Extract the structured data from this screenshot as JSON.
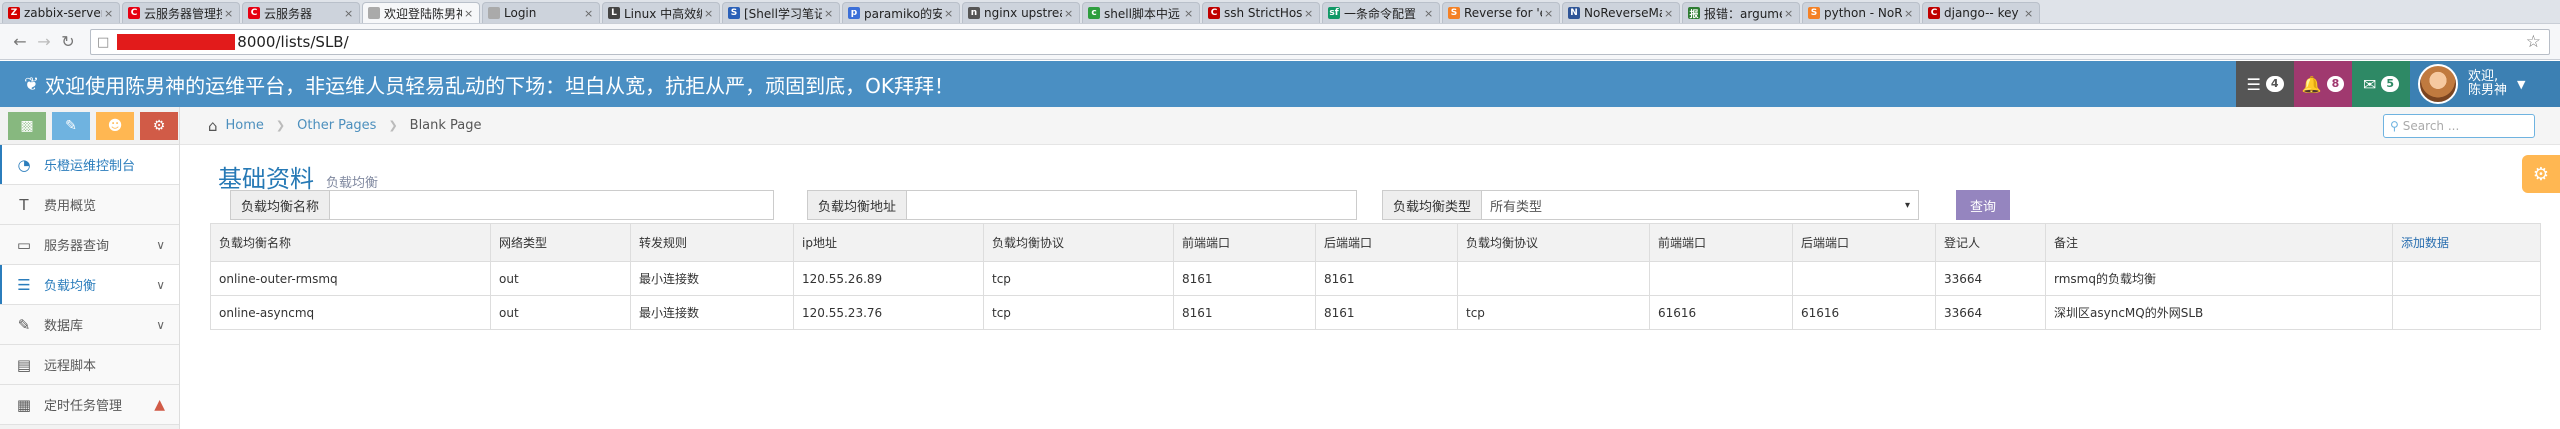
{
  "browser": {
    "tabs": [
      {
        "title": "zabbix-server",
        "fav": "Z",
        "color": "#d40000",
        "active": false
      },
      {
        "title": "云服务器管理控",
        "fav": "C",
        "color": "#e60012",
        "active": false
      },
      {
        "title": "云服务器",
        "fav": "C",
        "color": "#e60012",
        "active": false
      },
      {
        "title": "欢迎登陆陈男神",
        "fav": "",
        "color": "#aaaaaa",
        "active": true
      },
      {
        "title": "Login",
        "fav": "",
        "color": "#aaaaaa",
        "active": false
      },
      {
        "title": "Linux 中高效编",
        "fav": "L",
        "color": "#444444",
        "active": false
      },
      {
        "title": "[Shell学习笔记",
        "fav": "S",
        "color": "#2a60b8",
        "active": false
      },
      {
        "title": "paramiko的安",
        "fav": "p",
        "color": "#3b6fd8",
        "active": false
      },
      {
        "title": "nginx upstrea",
        "fav": "n",
        "color": "#555555",
        "active": false
      },
      {
        "title": "shell脚本中远",
        "fav": "c",
        "color": "#2e9e3e",
        "active": false
      },
      {
        "title": "ssh StrictHost",
        "fav": "C",
        "color": "#c00000",
        "active": false
      },
      {
        "title": "一条命令配置",
        "fav": "sf",
        "color": "#119966",
        "active": false
      },
      {
        "title": "Reverse for 'e",
        "fav": "S",
        "color": "#f48024",
        "active": false
      },
      {
        "title": "NoReverseMat",
        "fav": "N",
        "color": "#2f5597",
        "active": false
      },
      {
        "title": "报错：argume",
        "fav": "报",
        "color": "#2e7d32",
        "active": false
      },
      {
        "title": "python - NoR",
        "fav": "S",
        "color": "#f48024",
        "active": false
      },
      {
        "title": "django-- key",
        "fav": "C",
        "color": "#c00000",
        "active": false
      }
    ],
    "url_suffix": "8000/lists/SLB/"
  },
  "header": {
    "title": "欢迎使用陈男神的运维平台，非运维人员轻易乱动的下场：坦白从宽，抗拒从严，顽固到底，OK拜拜！",
    "tasks_count": "4",
    "notifications_count": "8",
    "messages_count": "5",
    "user_greeting": "欢迎,",
    "user_name": "陈男神"
  },
  "sidebar": {
    "items": [
      {
        "label": "乐橙运维控制台",
        "icon": "dashboard-icon",
        "active": true,
        "arrow": false
      },
      {
        "label": "费用概览",
        "icon": "text-icon",
        "active": false,
        "arrow": false
      },
      {
        "label": "服务器查询",
        "icon": "desktop-icon",
        "active": false,
        "arrow": true
      },
      {
        "label": "负载均衡",
        "icon": "list-icon",
        "active": true,
        "arrow": true
      },
      {
        "label": "数据库",
        "icon": "pencil-icon",
        "active": false,
        "arrow": true
      },
      {
        "label": "远程脚本",
        "icon": "list-alt-icon",
        "active": false,
        "arrow": false
      },
      {
        "label": "定时任务管理",
        "icon": "calendar-icon",
        "active": false,
        "arrow": false
      }
    ]
  },
  "breadcrumb": {
    "home": "Home",
    "section": "Other Pages",
    "current": "Blank Page"
  },
  "search": {
    "placeholder": "Search ..."
  },
  "page": {
    "title": "基础资料",
    "subtitle": "负载均衡"
  },
  "filters": {
    "name_label": "负载均衡名称",
    "name_value": "",
    "addr_label": "负载均衡地址",
    "addr_value": "",
    "type_label": "负载均衡类型",
    "type_value": "所有类型",
    "query_button": "查询"
  },
  "table": {
    "headers": [
      "负载均衡名称",
      "网络类型",
      "转发规则",
      "ip地址",
      "负载均衡协议",
      "前端端口",
      "后端端口",
      "负载均衡协议",
      "前端端口",
      "后端端口",
      "登记人",
      "备注",
      "添加数据"
    ],
    "rows": [
      [
        "online-outer-rmsmq",
        "out",
        "最小连接数",
        "120.55.26.89",
        "tcp",
        "8161",
        "8161",
        "",
        "",
        "",
        "33664",
        "rmsmq的负载均衡",
        ""
      ],
      [
        "online-asyncmq",
        "out",
        "最小连接数",
        "120.55.23.76",
        "tcp",
        "8161",
        "8161",
        "tcp",
        "61616",
        "61616",
        "33664",
        "深圳区asyncMQ的外网SLB",
        ""
      ]
    ]
  },
  "colors": {
    "header_bg": "#4a8fc3",
    "accent": "#2679b5",
    "query_button": "#9585bf"
  }
}
